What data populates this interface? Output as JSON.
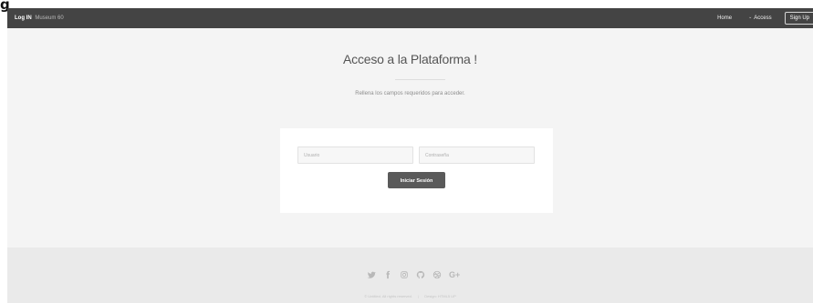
{
  "corner_glyph": "g",
  "topbar": {
    "brand": "Log IN",
    "brand_sub": "Museum 60",
    "nav": {
      "home": "Home",
      "access": "Access",
      "signup": "Sign Up"
    }
  },
  "main": {
    "title": "Acceso a la Plataforma !",
    "subtitle": "Rellena los campos requeridos para acceder.",
    "form": {
      "username_placeholder": "Usuario",
      "password_placeholder": "Contraseña",
      "button_label": "Iniciar Sesión"
    }
  },
  "footer": {
    "social_icons": [
      "twitter-icon",
      "facebook-icon",
      "instagram-icon",
      "github-icon",
      "dribbble-icon",
      "google-plus-icon"
    ],
    "google_plus_text": "G+",
    "copyright": "© Untitled. All rights reserved.",
    "design": "Design: HTML5 UP"
  }
}
